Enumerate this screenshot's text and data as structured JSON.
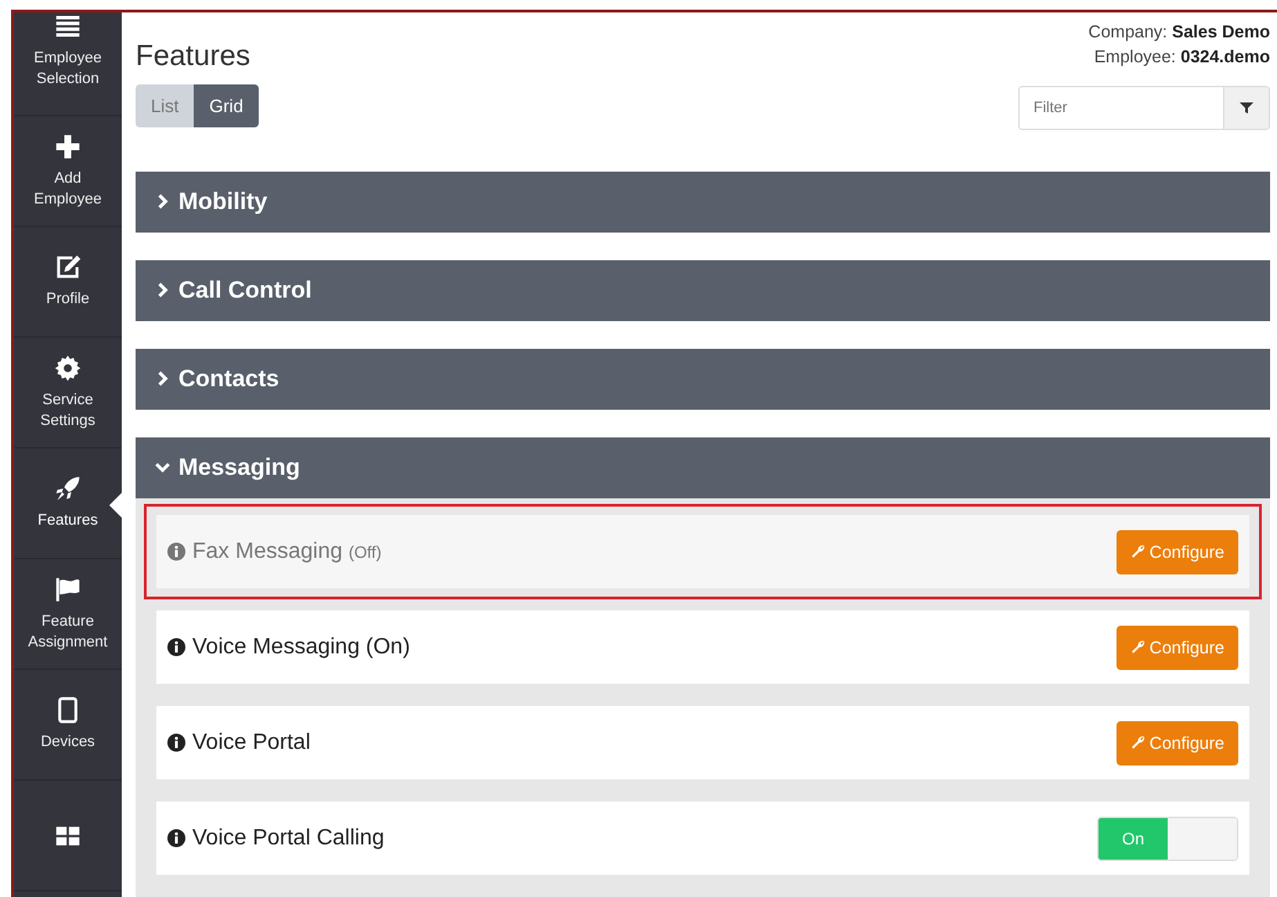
{
  "sidebar": {
    "items": [
      {
        "label": "Employee Selection",
        "selected": false
      },
      {
        "label": "Add Employee",
        "selected": false
      },
      {
        "label": "Profile",
        "selected": false
      },
      {
        "label": "Service Settings",
        "selected": false
      },
      {
        "label": "Features",
        "selected": true
      },
      {
        "label": "Feature Assignment",
        "selected": false
      },
      {
        "label": "Devices",
        "selected": false
      },
      {
        "selected": false
      }
    ]
  },
  "header": {
    "title": "Features",
    "company_label": "Company:",
    "company": "Sales Demo",
    "employee_label": "Employee:",
    "employee": "0324.demo"
  },
  "view_toggle": [
    {
      "label": "List",
      "selected": false
    },
    {
      "label": "Grid",
      "selected": true
    }
  ],
  "filter": {
    "placeholder": "Filter"
  },
  "sections": [
    {
      "title": "Mobility",
      "expanded": false
    },
    {
      "title": "Call Control",
      "expanded": false
    },
    {
      "title": "Contacts",
      "expanded": false
    },
    {
      "title": "Messaging",
      "expanded": true,
      "items": [
        {
          "label": "Fax Messaging",
          "note": "(Off)",
          "disabled": true,
          "highlighted": true,
          "kind": "configure",
          "button": "Configure"
        },
        {
          "label": "Voice Messaging (On)",
          "disabled": false,
          "highlighted": false,
          "kind": "configure",
          "button": "Configure"
        },
        {
          "label": "Voice Portal",
          "disabled": false,
          "highlighted": false,
          "kind": "configure",
          "button": "Configure"
        },
        {
          "label": "Voice Portal Calling",
          "disabled": false,
          "highlighted": false,
          "kind": "toggle",
          "on": true,
          "toggle_label": "On"
        }
      ]
    }
  ]
}
